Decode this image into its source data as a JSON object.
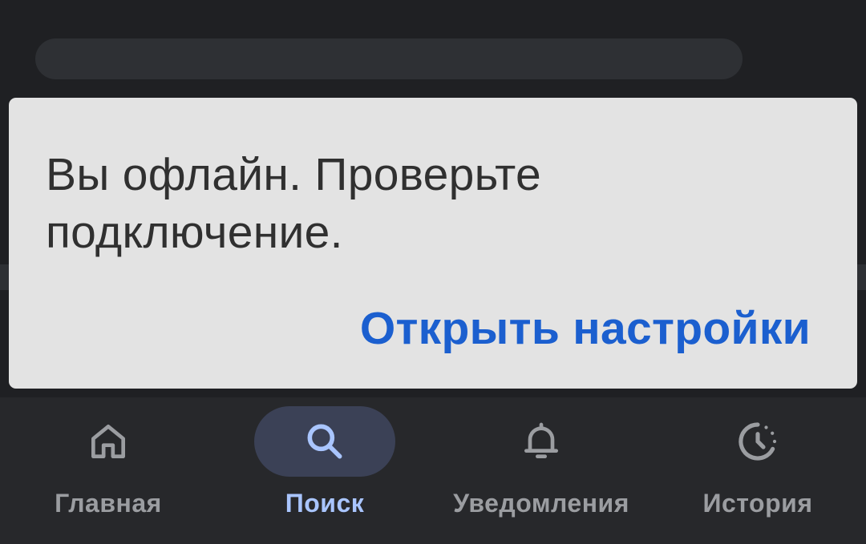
{
  "snackbar": {
    "message_line1": "Вы офлайн. Проверьте",
    "message_line2": "подключение.",
    "action_label": "Открыть настройки"
  },
  "bottom_nav": {
    "items": [
      {
        "label": "Главная",
        "icon": "home-icon",
        "active": false
      },
      {
        "label": "Поиск",
        "icon": "search-icon",
        "active": true
      },
      {
        "label": "Уведомления",
        "icon": "bell-icon",
        "active": false
      },
      {
        "label": "История",
        "icon": "history-icon",
        "active": false
      }
    ]
  },
  "colors": {
    "background": "#1f2023",
    "snackbar_bg": "#e3e3e3",
    "action_blue": "#1b5fcf",
    "nav_bg": "#27282b",
    "nav_active_pill": "#3b4156",
    "nav_active_text": "#a9c5ff",
    "nav_inactive": "#9b9da1"
  }
}
